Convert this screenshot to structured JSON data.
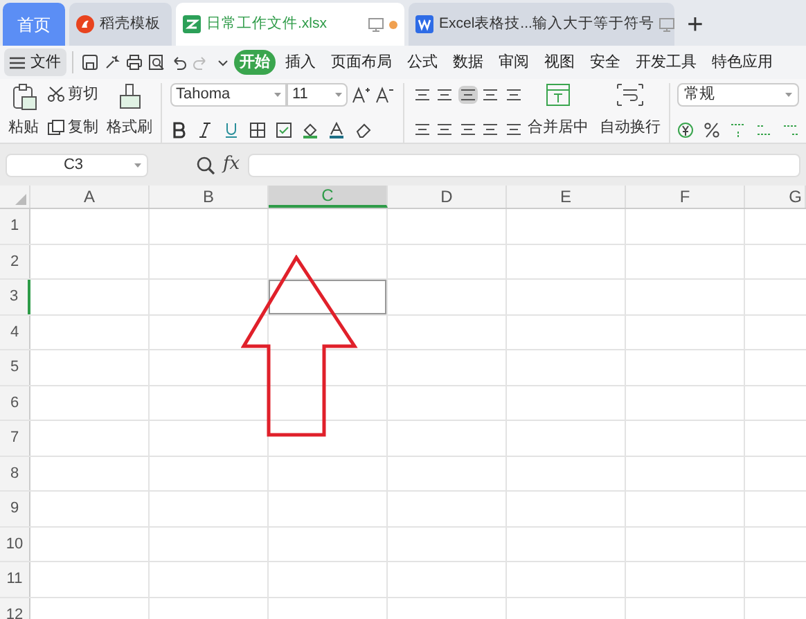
{
  "tabs": [
    {
      "kind": "home",
      "label": "首页",
      "selected": false
    },
    {
      "kind": "template",
      "label": "稻壳模板",
      "selected": false
    },
    {
      "kind": "sheet",
      "label": "日常工作文件.xlsx",
      "selected": true
    },
    {
      "kind": "doc",
      "label": "Excel表格技...输入大于等于符号",
      "selected": false
    }
  ],
  "new_tab": "+",
  "file_menu": "文件",
  "menu": [
    {
      "label": "开始",
      "selected": true
    },
    {
      "label": "插入",
      "selected": false
    },
    {
      "label": "页面布局",
      "selected": false
    },
    {
      "label": "公式",
      "selected": false
    },
    {
      "label": "数据",
      "selected": false
    },
    {
      "label": "审阅",
      "selected": false
    },
    {
      "label": "视图",
      "selected": false
    },
    {
      "label": "安全",
      "selected": false
    },
    {
      "label": "开发工具",
      "selected": false
    },
    {
      "label": "特色应用",
      "selected": false
    }
  ],
  "ribbon": {
    "paste": "粘贴",
    "cut": "剪切",
    "copy": "复制",
    "format_painter": "格式刷",
    "font": "Tahoma",
    "size": "11",
    "merge": "合并居中",
    "wrap": "自动换行",
    "number_format": "常规"
  },
  "formula_bar": {
    "name_box": "C3",
    "fx": "fx"
  },
  "columns": [
    {
      "label": "A",
      "selected": false
    },
    {
      "label": "B",
      "selected": false
    },
    {
      "label": "C",
      "selected": true
    },
    {
      "label": "D",
      "selected": false
    },
    {
      "label": "E",
      "selected": false
    },
    {
      "label": "F",
      "selected": false
    },
    {
      "label": "G",
      "selected": false
    }
  ],
  "rows": [
    {
      "label": "1",
      "selected": false
    },
    {
      "label": "2",
      "selected": false
    },
    {
      "label": "3",
      "selected": true
    },
    {
      "label": "4",
      "selected": false
    },
    {
      "label": "5",
      "selected": false
    },
    {
      "label": "6",
      "selected": false
    },
    {
      "label": "7",
      "selected": false
    },
    {
      "label": "8",
      "selected": false
    },
    {
      "label": "9",
      "selected": false
    },
    {
      "label": "10",
      "selected": false
    },
    {
      "label": "11",
      "selected": false
    },
    {
      "label": "12",
      "selected": false
    }
  ]
}
